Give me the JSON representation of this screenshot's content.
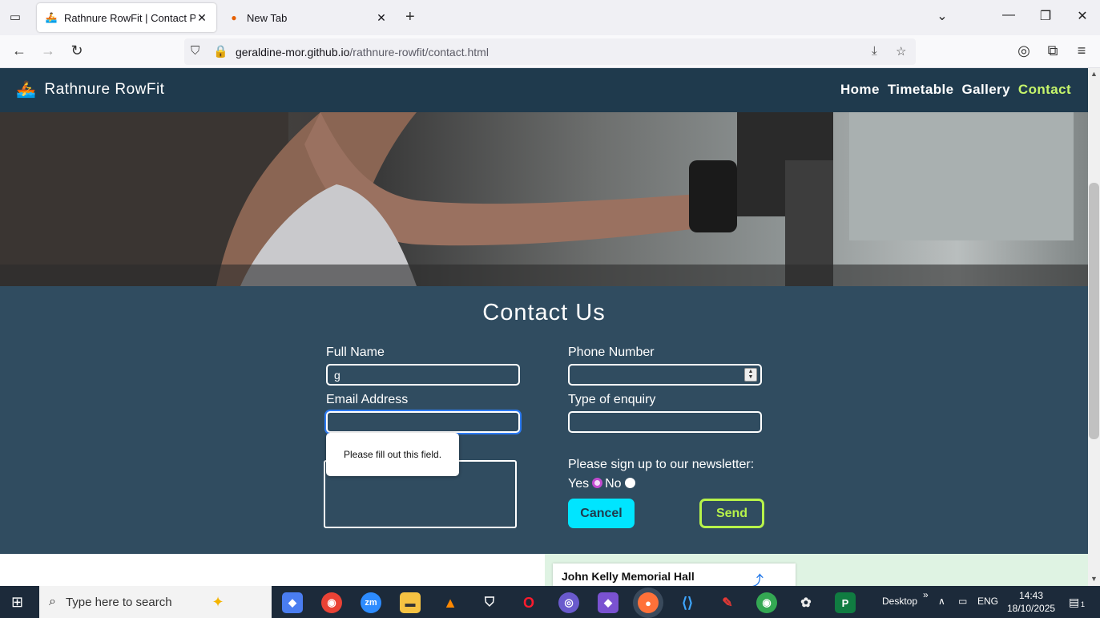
{
  "browser": {
    "tabs": [
      {
        "title": "Rathnure RowFit | Contact Page",
        "active": true
      },
      {
        "title": "New Tab",
        "active": false
      }
    ],
    "url_host": "geraldine-mor.github.io",
    "url_path": "/rathnure-rowfit/contact.html"
  },
  "site": {
    "brand": "Rathnure RowFit",
    "nav": [
      "Home",
      "Timetable",
      "Gallery",
      "Contact"
    ],
    "current_nav": "Contact"
  },
  "contact": {
    "heading": "Contact Us",
    "full_name_label": "Full Name",
    "full_name_value": "g",
    "phone_label": "Phone Number",
    "email_label": "Email Address",
    "enquiry_label": "Type of enquiry",
    "newsletter_label": "Please sign up to our newsletter:",
    "yes_label": "Yes",
    "no_label": "No",
    "newsletter_selected": "Yes",
    "cancel_label": "Cancel",
    "send_label": "Send",
    "validation_message": "Please fill out this field."
  },
  "map": {
    "place_name": "John Kelly Memorial Hall"
  },
  "taskbar": {
    "search_placeholder": "Type here to search",
    "desktop_label": "Desktop",
    "language": "ENG",
    "time": "14:43",
    "date": "18/10/2025",
    "notification_count": "1"
  },
  "colors": {
    "header_bg": "#1f3a4d",
    "section_bg": "#304c60",
    "nav_active": "#c6f56b",
    "cancel_bg": "#00e5ff",
    "send_border": "#b7f34a"
  }
}
